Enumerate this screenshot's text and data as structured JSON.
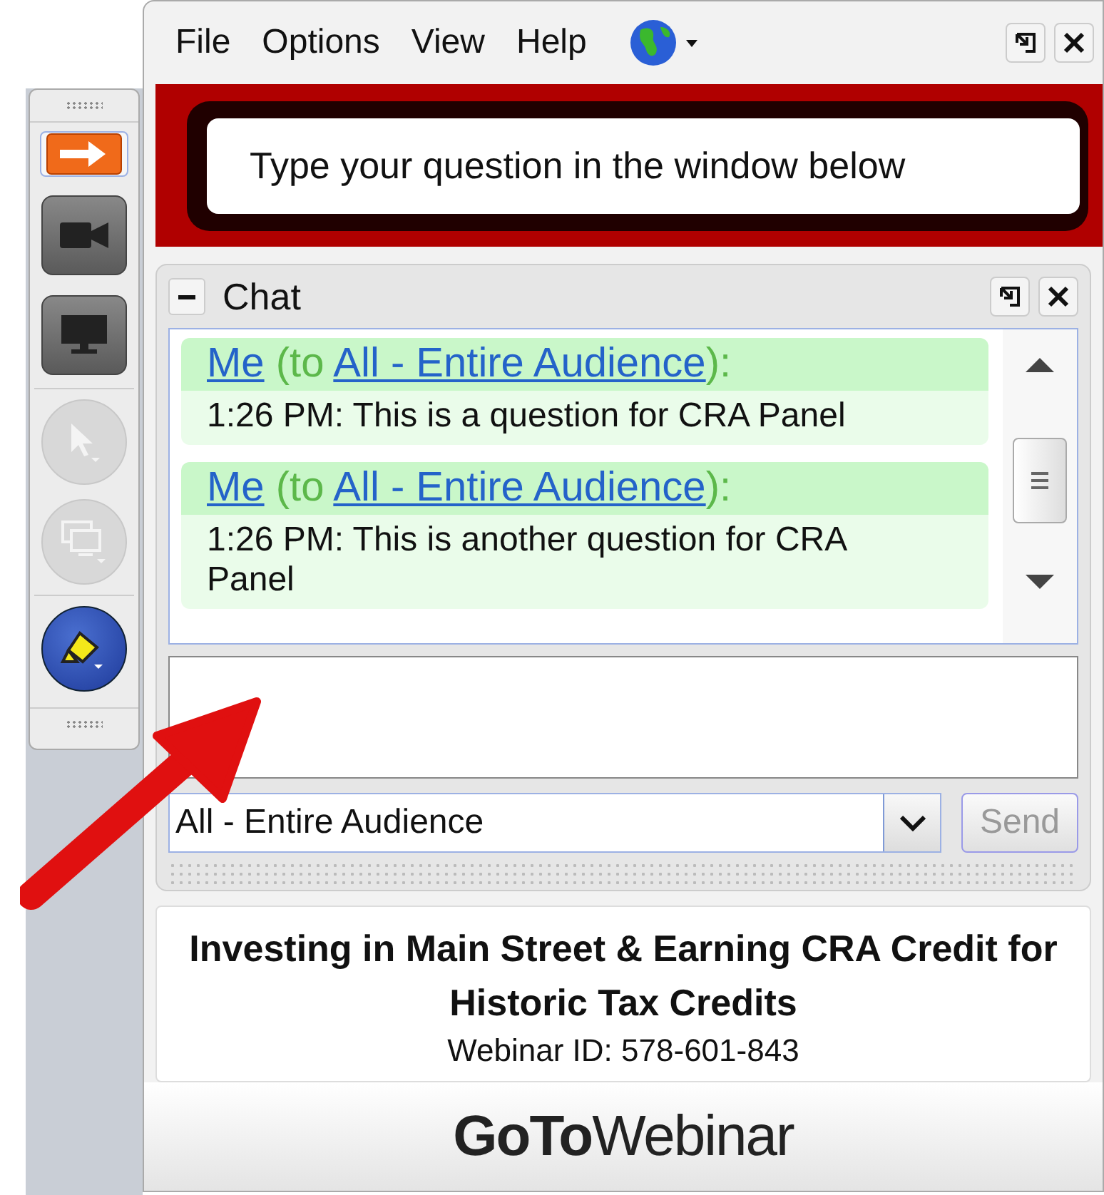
{
  "toolbar": {
    "tools": [
      {
        "kind": "arrow",
        "selected": true,
        "disabled": false
      },
      {
        "kind": "camera",
        "selected": false,
        "disabled": false
      },
      {
        "kind": "screen",
        "selected": false,
        "disabled": false
      },
      {
        "kind": "pointer",
        "selected": false,
        "disabled": true
      },
      {
        "kind": "screens",
        "selected": false,
        "disabled": true
      },
      {
        "kind": "highlighter",
        "selected": false,
        "disabled": false
      }
    ]
  },
  "menu": [
    "File",
    "Options",
    "View",
    "Help"
  ],
  "banner": {
    "text": "Type your question in the window below"
  },
  "chat": {
    "title": "Chat",
    "messages": [
      {
        "sender": "Me",
        "to": "(to",
        "recipient": "All - Entire Audience",
        "end": "):",
        "body": "1:26 PM: This is a question for CRA Panel"
      },
      {
        "sender": "Me",
        "to": "(to",
        "recipient": "All - Entire Audience",
        "end": "):",
        "body": "1:26 PM: This is another question for CRA Panel"
      }
    ],
    "audience": "All - Entire Audience",
    "send": {
      "label": "Send",
      "disabled": true
    }
  },
  "webinar": {
    "title": "Investing in Main Street & Earning CRA Credit for Historic Tax Credits",
    "id": "Webinar ID: 578-601-843"
  },
  "logo": "**GoTo**Webinar"
}
